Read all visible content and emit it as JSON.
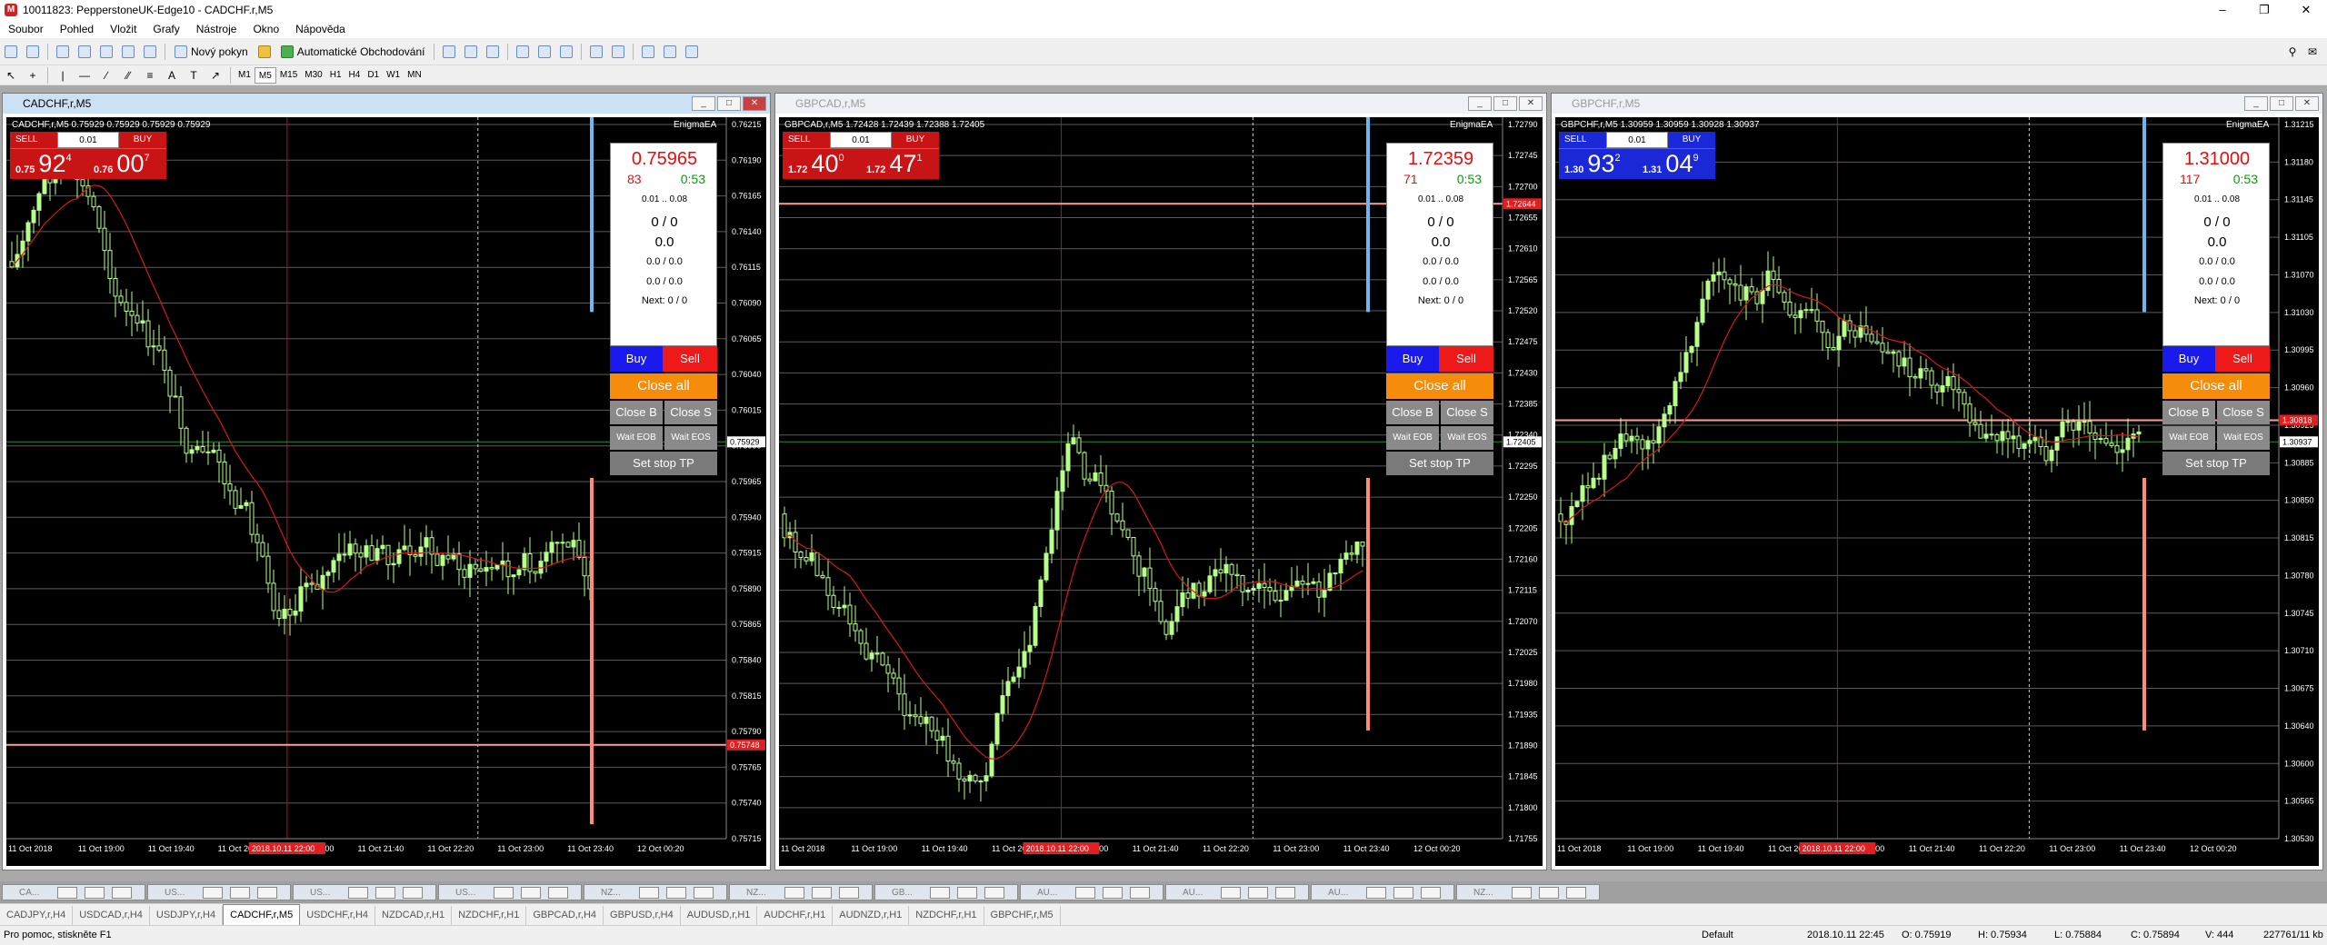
{
  "window": {
    "title": "10011823: PepperstoneUK-Edge10 - CADCHF.r,M5",
    "app_icon": "metatrader-icon"
  },
  "menu": [
    "Soubor",
    "Pohled",
    "Vložit",
    "Grafy",
    "Nástroje",
    "Okno",
    "Nápověda"
  ],
  "toolbar": {
    "new_order": "Nový pokyn",
    "autotrading": "Automatické Obchodování"
  },
  "timeframes": [
    "M1",
    "M5",
    "M15",
    "M30",
    "H1",
    "H4",
    "D1",
    "W1",
    "MN"
  ],
  "selected_timeframe": "M5",
  "charts": [
    {
      "title": "CADCHF,r,M5",
      "symbol_line": "CADCHF,r,M5  0.75929 0.75929 0.75929 0.75929",
      "ea": "EnigmaEA",
      "active": true,
      "lot": "0.01",
      "sell_label": "SELL",
      "buy_label": "BUY",
      "sell_small": "0.75",
      "sell_big": "92",
      "sell_pip": "4",
      "buy_small": "0.76",
      "buy_big": "00",
      "buy_pip": "7",
      "button_color": "#c81414",
      "price": "0.75965",
      "spread": "83",
      "time_left": "0:53",
      "range": "0.01 .. 0.08",
      "v1": "0 / 0",
      "v2": "0.0",
      "v3": "0.0 / 0.0",
      "v4": "0.0 / 0.0",
      "next": "Next: 0 / 0",
      "axis": [
        "0.76215",
        "0.76190",
        "0.76165",
        "0.76140",
        "0.76115",
        "0.76090",
        "0.76065",
        "0.76040",
        "0.76015",
        "0.75990",
        "0.75965",
        "0.75940",
        "0.75915",
        "0.75890",
        "0.75865",
        "0.75840",
        "0.75815",
        "0.75790",
        "0.75765",
        "0.75740",
        "0.75715"
      ],
      "current_price_label": "0.75929",
      "red_label": "0.75748",
      "times": [
        "11 Oct 2018",
        "11 Oct 19:00",
        "11 Oct 19:40",
        "11 Oct 20:20",
        "11 Oct 21:00",
        "11 Oct 21:40",
        "11 Oct 22:20",
        "11 Oct 23:00",
        "11 Oct 23:40",
        "12 Oct 00:20"
      ],
      "highlight_time": "2018.10.11 22:00"
    },
    {
      "title": "GBPCAD,r,M5",
      "symbol_line": "GBPCAD,r,M5  1.72428 1.72439 1.72388 1.72405",
      "ea": "EnigmaEA",
      "active": false,
      "lot": "0.01",
      "sell_label": "SELL",
      "buy_label": "BUY",
      "sell_small": "1.72",
      "sell_big": "40",
      "sell_pip": "0",
      "buy_small": "1.72",
      "buy_big": "47",
      "buy_pip": "1",
      "button_color": "#c81414",
      "price": "1.72359",
      "spread": "71",
      "time_left": "0:53",
      "range": "0.01 .. 0.08",
      "v1": "0 / 0",
      "v2": "0.0",
      "v3": "0.0 / 0.0",
      "v4": "0.0 / 0.0",
      "next": "Next: 0 / 0",
      "axis": [
        "1.72790",
        "1.72745",
        "1.72700",
        "1.72655",
        "1.72610",
        "1.72565",
        "1.72520",
        "1.72475",
        "1.72430",
        "1.72385",
        "1.72340",
        "1.72295",
        "1.72250",
        "1.72205",
        "1.72160",
        "1.72115",
        "1.72070",
        "1.72025",
        "1.71980",
        "1.71935",
        "1.71890",
        "1.71845",
        "1.71800",
        "1.71755"
      ],
      "current_price_label": "1.72405",
      "red_label": "1.72644",
      "times": [
        "11 Oct 2018",
        "11 Oct 19:00",
        "11 Oct 19:40",
        "11 Oct 20:20",
        "11 Oct 21:00",
        "11 Oct 21:40",
        "11 Oct 22:20",
        "11 Oct 23:00",
        "11 Oct 23:40",
        "12 Oct 00:20"
      ],
      "highlight_time": "2018.10.11 22:00"
    },
    {
      "title": "GBPCHF,r,M5",
      "symbol_line": "GBPCHF,r,M5  1.30959 1.30959 1.30928 1.30937",
      "ea": "EnigmaEA",
      "active": false,
      "lot": "0.01",
      "sell_label": "SELL",
      "buy_label": "BUY",
      "sell_small": "1.30",
      "sell_big": "93",
      "sell_pip": "2",
      "buy_small": "1.31",
      "buy_big": "04",
      "buy_pip": "9",
      "button_color": "#1a28d8",
      "price": "1.31000",
      "spread": "117",
      "time_left": "0:53",
      "range": "0.01 .. 0.08",
      "v1": "0 / 0",
      "v2": "0.0",
      "v3": "0.0 / 0.0",
      "v4": "0.0 / 0.0",
      "next": "Next: 0 / 0",
      "axis": [
        "1.31215",
        "1.31180",
        "1.31145",
        "1.31105",
        "1.31070",
        "1.31030",
        "1.30995",
        "1.30960",
        "1.30925",
        "1.30885",
        "1.30850",
        "1.30815",
        "1.30780",
        "1.30745",
        "1.30710",
        "1.30675",
        "1.30640",
        "1.30600",
        "1.30565",
        "1.30530"
      ],
      "current_price_label": "1.30937",
      "red_label": "1.30818",
      "times": [
        "11 Oct 2018",
        "11 Oct 19:00",
        "11 Oct 19:40",
        "11 Oct 20:20",
        "11 Oct 21:00",
        "11 Oct 21:40",
        "11 Oct 22:20",
        "11 Oct 23:00",
        "11 Oct 23:40",
        "12 Oct 00:20"
      ],
      "highlight_time": "2018.10.11 22:00"
    }
  ],
  "panel_buttons": {
    "buy": "Buy",
    "sell": "Sell",
    "close_all": "Close all",
    "close_b": "Close B",
    "close_s": "Close S",
    "wait_eob": "Wait EOB",
    "wait_eos": "Wait EOS",
    "set_stop": "Set stop TP"
  },
  "window_tabs": [
    "CA...",
    "US...",
    "US...",
    "US...",
    "NZ...",
    "NZ...",
    "GB...",
    "AU...",
    "AU...",
    "AU...",
    "NZ..."
  ],
  "symbol_tabs": [
    "CADJPY,r,H4",
    "USDCAD,r,H4",
    "USDJPY,r,H4",
    "CADCHF,r,M5",
    "USDCHF,r,H4",
    "NZDCAD,r,H1",
    "NZDCHF,r,H1",
    "GBPCAD,r,H4",
    "GBPUSD,r,H4",
    "AUDUSD,r,H1",
    "AUDCHF,r,H1",
    "AUDNZD,r,H1",
    "NZDCHF,r,H1",
    "GBPCHF,r,M5"
  ],
  "selected_symbol_tab": "CADCHF,r,M5",
  "status": {
    "help": "Pro pomoc, stiskněte F1",
    "profile": "Default",
    "time": "2018.10.11 22:45",
    "open": "O: 0.75919",
    "high": "H: 0.75934",
    "low": "L: 0.75884",
    "close": "C: 0.75894",
    "volume": "V: 444",
    "traffic": "227761/11 kb"
  },
  "colors": {
    "candle": "#b6ff8a",
    "ma": "#d41a1a",
    "grid": "#5a5a5a",
    "sell_red": "#c81414",
    "buy_blue": "#1a28d8",
    "close_all": "#f58c0a"
  }
}
